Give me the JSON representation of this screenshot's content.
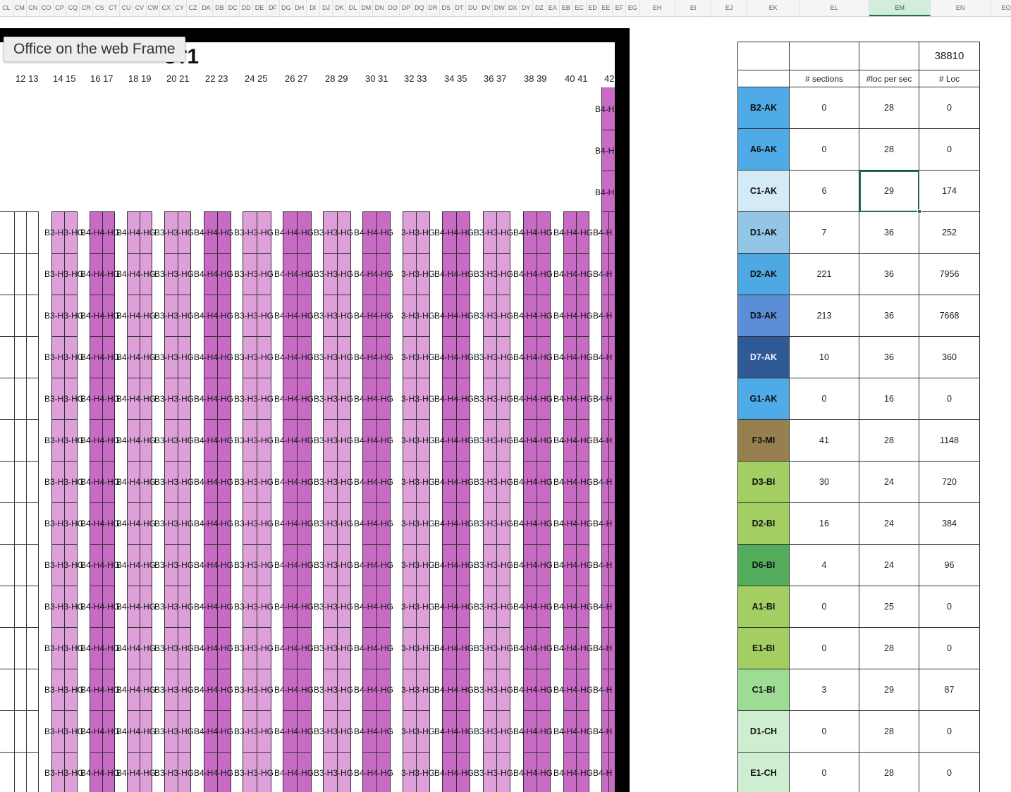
{
  "window": {
    "tooltip": "Office on the web Frame"
  },
  "column_headers": [
    "CL",
    "CM",
    "CN",
    "CO",
    "CP",
    "CQ",
    "CR",
    "CS",
    "CT",
    "CU",
    "CV",
    "CW",
    "CX",
    "CY",
    "CZ",
    "DA",
    "DB",
    "DC",
    "DD",
    "DE",
    "DF",
    "DG",
    "DH",
    "DI",
    "DJ",
    "DK",
    "DL",
    "DM",
    "DN",
    "DO",
    "DP",
    "DQ",
    "DR",
    "DS",
    "DT",
    "DU",
    "DV",
    "DW",
    "DX",
    "DY",
    "DZ",
    "EA",
    "EB",
    "EC",
    "ED",
    "EE",
    "EF",
    "EG",
    "EH",
    "EI",
    "EJ",
    "EK",
    "EL",
    "EM",
    "EN",
    "EO"
  ],
  "selected_column": "EM",
  "frame": {
    "title": "ʊʕ1",
    "column_numbers": [
      "12 13",
      "14 15",
      "16 17",
      "18 19",
      "20 21",
      "22 23",
      "24 25",
      "26 27",
      "28 29",
      "30 31",
      "32 33",
      "34 35",
      "36 37",
      "38 39",
      "40 41",
      "42"
    ],
    "top_right_labels": [
      "B4-H",
      "B4-H",
      "B4-H"
    ],
    "pair_labels": [
      "B3-H3-HG",
      "B4-H4-HG",
      "B4-H4-HG",
      "B3-H3-HG",
      "B4-H4-HG",
      "B3-H3-HG",
      "B4-H4-HG",
      "B3-H3-HG",
      "B4-H4-HG",
      "3-H3-HG",
      "B4-H4-HG",
      "B3-H3-HG",
      "B4-H4-HG",
      "B4-H4-HG",
      "B4-H"
    ],
    "row_count": 14,
    "colors": {
      "light": "#dda0d8",
      "dark": "#c86bc4"
    }
  },
  "summary": {
    "total": "38810",
    "headers": [
      "",
      "# sections",
      "#loc per sec",
      "# Loc"
    ],
    "rows": [
      {
        "code": "B2-AK",
        "sections": "0",
        "loc_per_sec": "28",
        "loc": "0",
        "color": "#4fabe8",
        "text": "#111"
      },
      {
        "code": "A6-AK",
        "sections": "0",
        "loc_per_sec": "28",
        "loc": "0",
        "color": "#4fabe8",
        "text": "#111"
      },
      {
        "code": "C1-AK",
        "sections": "6",
        "loc_per_sec": "29",
        "loc": "174",
        "color": "#d4eaf7",
        "text": "#111"
      },
      {
        "code": "D1-AK",
        "sections": "7",
        "loc_per_sec": "36",
        "loc": "252",
        "color": "#93c5e6",
        "text": "#111"
      },
      {
        "code": "D2-AK",
        "sections": "221",
        "loc_per_sec": "36",
        "loc": "7956",
        "color": "#4ea8e2",
        "text": "#111"
      },
      {
        "code": "D3-AK",
        "sections": "213",
        "loc_per_sec": "36",
        "loc": "7668",
        "color": "#5b8ed6",
        "text": "#111"
      },
      {
        "code": "D7-AK",
        "sections": "10",
        "loc_per_sec": "36",
        "loc": "360",
        "color": "#2f5a96",
        "text": "#eef"
      },
      {
        "code": "G1-AK",
        "sections": "0",
        "loc_per_sec": "16",
        "loc": "0",
        "color": "#4fabe8",
        "text": "#111"
      },
      {
        "code": "F3-MI",
        "sections": "41",
        "loc_per_sec": "28",
        "loc": "1148",
        "color": "#978050",
        "text": "#111"
      },
      {
        "code": "D3-BI",
        "sections": "30",
        "loc_per_sec": "24",
        "loc": "720",
        "color": "#a3cf62",
        "text": "#111"
      },
      {
        "code": "D2-BI",
        "sections": "16",
        "loc_per_sec": "24",
        "loc": "384",
        "color": "#a3cf62",
        "text": "#111"
      },
      {
        "code": "D6-BI",
        "sections": "4",
        "loc_per_sec": "24",
        "loc": "96",
        "color": "#54ad5c",
        "text": "#111"
      },
      {
        "code": "A1-BI",
        "sections": "0",
        "loc_per_sec": "25",
        "loc": "0",
        "color": "#a3cf62",
        "text": "#111"
      },
      {
        "code": "E1-BI",
        "sections": "0",
        "loc_per_sec": "28",
        "loc": "0",
        "color": "#a3cf62",
        "text": "#111"
      },
      {
        "code": "C1-BI",
        "sections": "3",
        "loc_per_sec": "29",
        "loc": "87",
        "color": "#9edc96",
        "text": "#111"
      },
      {
        "code": "D1-CH",
        "sections": "0",
        "loc_per_sec": "28",
        "loc": "0",
        "color": "#cdeed0",
        "text": "#111"
      },
      {
        "code": "E1-CH",
        "sections": "0",
        "loc_per_sec": "28",
        "loc": "0",
        "color": "#cdeed0",
        "text": "#111"
      }
    ],
    "selected_cell": {
      "row": 2,
      "col": "loc_per_sec"
    }
  }
}
